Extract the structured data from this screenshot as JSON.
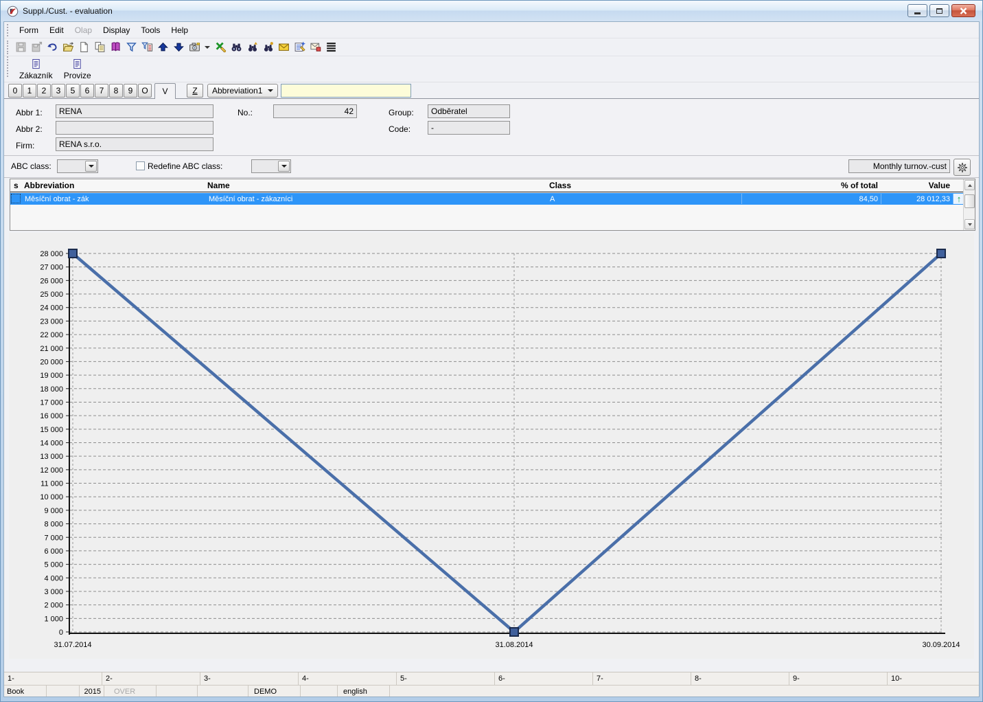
{
  "window": {
    "title": "Suppl./Cust. - evaluation"
  },
  "menu": {
    "items": [
      {
        "label": "Form",
        "enabled": true
      },
      {
        "label": "Edit",
        "enabled": true
      },
      {
        "label": "Olap",
        "enabled": false
      },
      {
        "label": "Display",
        "enabled": true
      },
      {
        "label": "Tools",
        "enabled": true
      },
      {
        "label": "Help",
        "enabled": true
      }
    ]
  },
  "toolbar": {
    "icons": [
      "save",
      "save-as",
      "undo",
      "open",
      "new-document",
      "copy",
      "catalog-book",
      "filter",
      "filter-form",
      "move-up",
      "move-down",
      "snapshot",
      "snapshot-dropdown",
      "export-edit",
      "find",
      "find-previous",
      "find-next",
      "send-mail",
      "edit-journal",
      "mail-options",
      "field-list"
    ]
  },
  "shortcuts": {
    "buttons": [
      {
        "label": "Zákazník",
        "icon": "form-document"
      },
      {
        "label": "Provize",
        "icon": "form-document"
      }
    ]
  },
  "tabstrip": {
    "tabs": [
      "0",
      "1",
      "2",
      "3",
      "5",
      "6",
      "7",
      "8",
      "9",
      "O",
      "V"
    ],
    "active_tab": "V",
    "z_button_label": "Z",
    "field_selector_value": "Abbreviation1",
    "search_value": ""
  },
  "form": {
    "abbr1_label": "Abbr 1:",
    "abbr1_value": "RENA",
    "no_label": "No.:",
    "no_value": "42",
    "group_label": "Group:",
    "group_value": "Odběratel",
    "abbr2_label": "Abbr 2:",
    "abbr2_value": "",
    "code_label": "Code:",
    "code_value": "-",
    "firm_label": "Firm:",
    "firm_value": "RENA s.r.o."
  },
  "abc_row": {
    "abc_class_label": "ABC class:",
    "abc_class_value": "",
    "redefine_checked": false,
    "redefine_label": "Redefine ABC class:",
    "redefine_value": "",
    "monthly_field_value": "Monthly turnov.-cust"
  },
  "table": {
    "columns": [
      "s",
      "Abbreviation",
      "Name",
      "Class",
      "% of total",
      "Value"
    ],
    "rows": [
      {
        "selected": true,
        "abbreviation": "Měsíční obrat - zák",
        "name": "Měsíční obrat - zákazníci",
        "class": "A",
        "pct_of_total": "84,50",
        "value": "28 012,33",
        "trend": "up",
        "trend_color": "#0fa04a"
      }
    ]
  },
  "chart_data": {
    "type": "line",
    "title": "",
    "x": [
      "31.07.2014",
      "31.08.2014",
      "30.09.2014"
    ],
    "series": [
      {
        "name": "Měsíční obrat - zákazníci",
        "values": [
          28000,
          0,
          28000
        ]
      }
    ],
    "ylim": [
      0,
      28000
    ],
    "ytick_step": 1000,
    "xlabel": "",
    "ylabel": "",
    "grid": "dashed",
    "legend": "none",
    "line_color": "#4a6fa9",
    "marker": "square"
  },
  "statusbar": {
    "fkeys": [
      "1-",
      "2-",
      "3-",
      "4-",
      "5-",
      "6-",
      "7-",
      "8-",
      "9-",
      "10-"
    ],
    "cells": [
      "Book",
      "",
      "2015",
      "OVER",
      "",
      "",
      "DEMO",
      "",
      "english",
      ""
    ]
  }
}
